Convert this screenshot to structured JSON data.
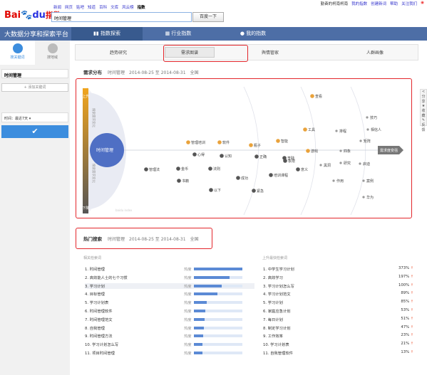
{
  "top_nav": {
    "items": [
      "新闻",
      "网页",
      "贴吧",
      "知道",
      "百科",
      "文库",
      "风云榜",
      "指数"
    ],
    "current_index": 7
  },
  "user_bar": {
    "items": [
      "勤奋的柯南柯南",
      "我的指数",
      "创建新词",
      "帮助",
      "关注我们"
    ]
  },
  "logo": {
    "bai": "Bai",
    "du": "du",
    "suffix": "指数"
  },
  "search": {
    "value": "时间管理",
    "button": "百度一下"
  },
  "header": {
    "slogan": "大数据分享和探索平台",
    "tabs": [
      {
        "label": "指数探索",
        "icon": "bar-chart-icon"
      },
      {
        "label": "行业指数",
        "icon": "building-icon"
      },
      {
        "label": "我的指数",
        "icon": "person-icon"
      }
    ],
    "active_tab": 0
  },
  "sidebar": {
    "tabs": [
      "搜关键词",
      "搜地域"
    ],
    "keyword": "时间管理",
    "add_keyword": "+ 添加关键词",
    "period": "时间：最近7天 ▾",
    "confirm_icon": "checkmark-icon"
  },
  "subnav": {
    "tabs": [
      "趋势研究",
      "需求图谱",
      "舆情管家",
      "人群画像"
    ],
    "active": 1
  },
  "demand": {
    "title": "需求分布",
    "info": "时间管理",
    "range": "2014-08-25 至 2014-08-31",
    "scope": "全国",
    "up_label": "上升",
    "down_label": "下降",
    "left_top_text": "搜索需求变化",
    "left_bottom_text": "搜索需求变化",
    "right_label": "需求度变强",
    "watermark": "baidu index",
    "center": "时间管理",
    "nodes": [
      {
        "t": "管理培训",
        "c": "#e9a23b"
      },
      {
        "t": "软件",
        "c": "#e9a23b"
      },
      {
        "t": "心得",
        "c": "#555"
      },
      {
        "t": "认知",
        "c": "#555"
      },
      {
        "t": "管理法",
        "c": "#555"
      },
      {
        "t": "金币",
        "c": "#555"
      },
      {
        "t": "法则",
        "c": "#555"
      },
      {
        "t": "书籍",
        "c": "#555"
      },
      {
        "t": "以下",
        "c": "#555"
      },
      {
        "t": "成功",
        "c": "#555"
      },
      {
        "t": "正确",
        "c": "#555"
      },
      {
        "t": "培训课程",
        "c": "#555"
      },
      {
        "t": "紧急",
        "c": "#555"
      },
      {
        "t": "象限",
        "c": "#555"
      },
      {
        "t": "瓶子",
        "c": "#e9a23b"
      },
      {
        "t": "智能",
        "c": "#e9a23b"
      },
      {
        "t": "李践",
        "c": "#555"
      },
      {
        "t": "意义",
        "c": "#555"
      },
      {
        "t": "工具",
        "c": "#e9a23b"
      },
      {
        "t": "游戏",
        "c": "#e9a23b"
      },
      {
        "t": "黑洞",
        "c": "#999"
      },
      {
        "t": "作用",
        "c": "#999"
      },
      {
        "t": "查看",
        "c": "#e9a23b"
      },
      {
        "t": "排程",
        "c": "#999"
      },
      {
        "t": "四象",
        "c": "#999"
      },
      {
        "t": "研究",
        "c": "#999"
      },
      {
        "t": "技巧",
        "c": "#999"
      },
      {
        "t": "相信人",
        "c": "#999"
      },
      {
        "t": "矩阵",
        "c": "#999"
      },
      {
        "t": "启迪",
        "c": "#999"
      },
      {
        "t": "案例",
        "c": "#999"
      },
      {
        "t": "华为",
        "c": "#999"
      }
    ]
  },
  "hot": {
    "title": "热门搜索",
    "info": "时间管理",
    "range": "2014-08-25 至 2014-08-31",
    "scope": "全国",
    "left_header": "相关检索词",
    "right_header": "上升最快检索词",
    "hot_label": "热度",
    "left": [
      {
        "n": "1.",
        "t": "时间管理",
        "v": 1.0
      },
      {
        "n": "2.",
        "t": "高效能人士的七个习惯",
        "v": 0.74
      },
      {
        "n": "3.",
        "t": "学习计划",
        "v": 0.58
      },
      {
        "n": "4.",
        "t": "目标管理",
        "v": 0.48
      },
      {
        "n": "5.",
        "t": "学习计划表",
        "v": 0.26
      },
      {
        "n": "6.",
        "t": "时间管理软件",
        "v": 0.23
      },
      {
        "n": "7.",
        "t": "时间管理范文",
        "v": 0.22
      },
      {
        "n": "8.",
        "t": "自我管理",
        "v": 0.21
      },
      {
        "n": "9.",
        "t": "时间管理方法",
        "v": 0.19
      },
      {
        "n": "10.",
        "t": "学习计划怎么写",
        "v": 0.18
      },
      {
        "n": "11.",
        "t": "项目时间管理",
        "v": 0.17
      }
    ],
    "right": [
      {
        "n": "1.",
        "t": "中学生学习计划",
        "p": "373%"
      },
      {
        "n": "2.",
        "t": "高效学习",
        "p": "197%"
      },
      {
        "n": "3.",
        "t": "学习计划怎么写",
        "p": "100%"
      },
      {
        "n": "4.",
        "t": "学习计划范文",
        "p": "89%"
      },
      {
        "n": "5.",
        "t": "学习计划",
        "p": "85%"
      },
      {
        "n": "6.",
        "t": "家庭应急计划",
        "p": "53%"
      },
      {
        "n": "7.",
        "t": "每日计划",
        "p": "51%"
      },
      {
        "n": "8.",
        "t": "制定学习计划",
        "p": "47%"
      },
      {
        "n": "9.",
        "t": "工作效率",
        "p": "23%"
      },
      {
        "n": "10.",
        "t": "学习计划表",
        "p": "21%"
      },
      {
        "n": "11.",
        "t": "自我管理软件",
        "p": "13%"
      }
    ]
  },
  "right_tools": [
    "分享",
    "收藏",
    "反馈"
  ],
  "colors": {
    "brand_blue": "#4d6ea6",
    "accent": "#3c8dde",
    "highlight": "#e3262b",
    "orange": "#e9a23b"
  }
}
